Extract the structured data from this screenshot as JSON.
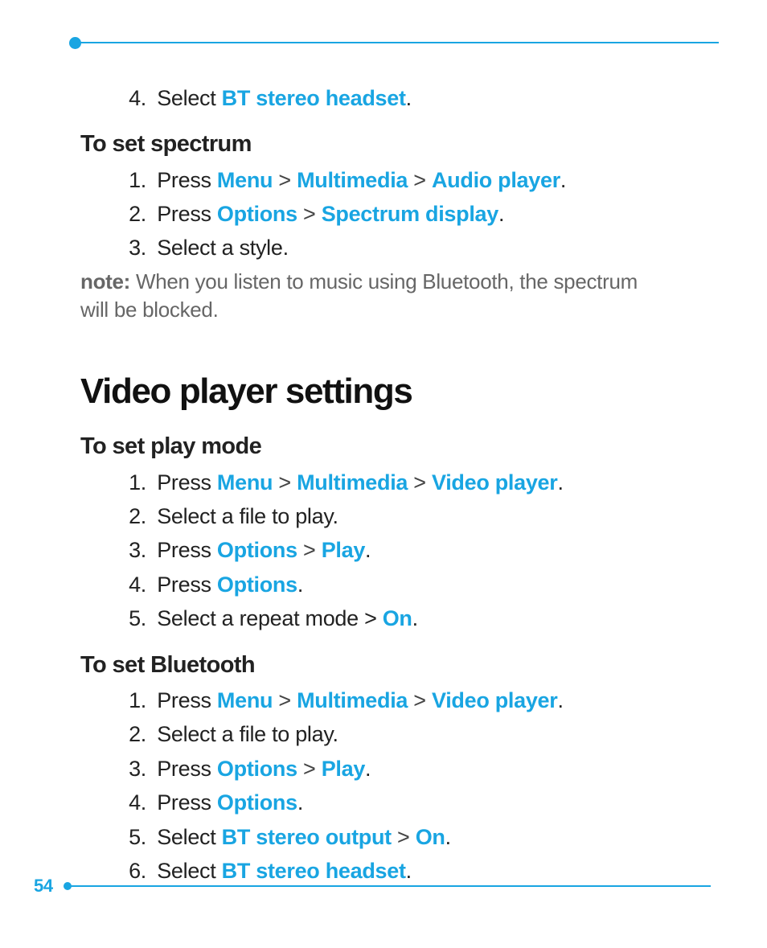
{
  "pageNumber": "54",
  "secA": {
    "step4_num": "4.",
    "step4_pre": "Select ",
    "step4_hl": "BT stereo headset",
    "step4_post": "."
  },
  "spectrum": {
    "heading": "To set spectrum",
    "s1_num": "1.",
    "s1_pre": "Press ",
    "s1_a": "Menu",
    "s1_gt1": " > ",
    "s1_b": "Multimedia",
    "s1_gt2": " > ",
    "s1_c": "Audio player",
    "s1_post": ".",
    "s2_num": "2.",
    "s2_pre": "Press ",
    "s2_a": "Options",
    "s2_gt1": " > ",
    "s2_b": "Spectrum display",
    "s2_post": ".",
    "s3_num": "3.",
    "s3_text": "Select a style.",
    "note_label": "note: ",
    "note_text": "When you listen to music using Bluetooth, the spectrum will be blocked."
  },
  "video": {
    "title": "Video player settings"
  },
  "playmode": {
    "heading": "To set play mode",
    "s1_num": "1.",
    "s1_pre": "Press ",
    "s1_a": "Menu",
    "s1_gt1": " > ",
    "s1_b": "Multimedia",
    "s1_gt2": " > ",
    "s1_c": "Video player",
    "s1_post": ".",
    "s2_num": "2.",
    "s2_text": "Select a file to play.",
    "s3_num": "3.",
    "s3_pre": "Press ",
    "s3_a": "Options",
    "s3_gt1": " > ",
    "s3_b": "Play",
    "s3_post": ".",
    "s4_num": "4.",
    "s4_pre": "Press ",
    "s4_a": "Options",
    "s4_post": ".",
    "s5_num": "5.",
    "s5_pre": "Select a repeat mode > ",
    "s5_a": "On",
    "s5_post": "."
  },
  "bt": {
    "heading": "To set Bluetooth",
    "s1_num": "1.",
    "s1_pre": "Press ",
    "s1_a": "Menu",
    "s1_gt1": " > ",
    "s1_b": "Multimedia",
    "s1_gt2": " > ",
    "s1_c": "Video player",
    "s1_post": ".",
    "s2_num": "2.",
    "s2_text": "Select a file to play.",
    "s3_num": "3.",
    "s3_pre": "Press ",
    "s3_a": "Options",
    "s3_gt1": " > ",
    "s3_b": "Play",
    "s3_post": ".",
    "s4_num": "4.",
    "s4_pre": "Press ",
    "s4_a": "Options",
    "s4_post": ".",
    "s5_num": "5.",
    "s5_pre": "Select ",
    "s5_a": "BT stereo output",
    "s5_gt1": " > ",
    "s5_b": "On",
    "s5_post": ".",
    "s6_num": "6.",
    "s6_pre": "Select ",
    "s6_a": "BT stereo headset",
    "s6_post": "."
  }
}
